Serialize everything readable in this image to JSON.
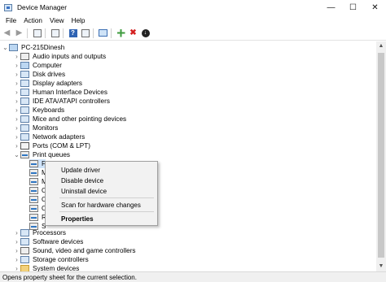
{
  "window": {
    "title": "Device Manager"
  },
  "menu": [
    "File",
    "Action",
    "View",
    "Help"
  ],
  "toolbar": {
    "icons": [
      "back-arrow-icon",
      "forward-arrow-icon",
      "properties-icon",
      "details-icon",
      "help-icon",
      "monitor-icon",
      "add-driver-icon",
      "uninstall-icon",
      "download-icon"
    ]
  },
  "tree": {
    "root": "PC-215Dinesh",
    "categories": [
      "Audio inputs and outputs",
      "Computer",
      "Disk drives",
      "Display adapters",
      "Human Interface Devices",
      "IDE ATA/ATAPI controllers",
      "Keyboards",
      "Mice and other pointing devices",
      "Monitors",
      "Network adapters",
      "Ports (COM & LPT)",
      "Print queues"
    ],
    "print_queue_children": [
      "F",
      "M",
      "M",
      "O",
      "O",
      "O",
      "R",
      "S"
    ],
    "after": [
      "Processors",
      "Software devices",
      "Sound, video and game controllers",
      "Storage controllers",
      "System devices"
    ]
  },
  "context_menu": {
    "items": [
      "Update driver",
      "Disable device",
      "Uninstall device",
      "Scan for hardware changes",
      "Properties"
    ]
  },
  "status": {
    "text": "Opens property sheet for the current selection."
  }
}
